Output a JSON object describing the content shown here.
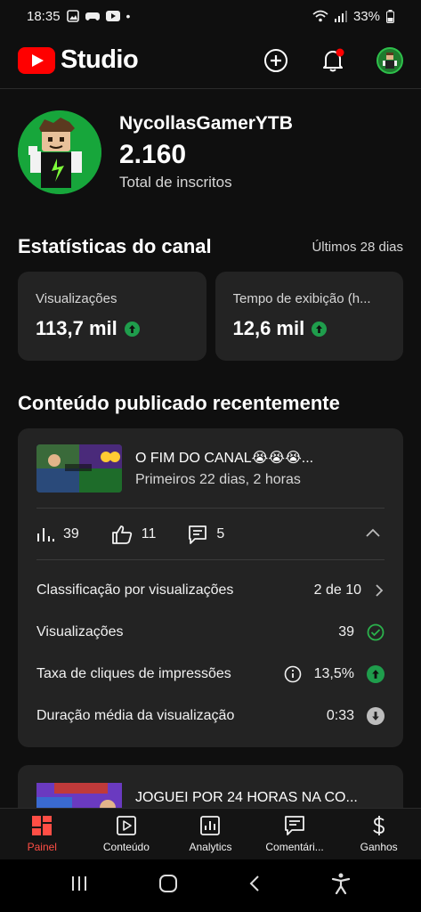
{
  "status_bar": {
    "time": "18:35",
    "battery": "33%"
  },
  "app": {
    "brand": "Studio",
    "accent": "#ff0000"
  },
  "channel": {
    "name": "NycollasGamerYTB",
    "subscribers": "2.160",
    "subscribers_label": "Total de inscritos"
  },
  "stats": {
    "title": "Estatísticas do canal",
    "period": "Últimos 28 dias",
    "cards": [
      {
        "label": "Visualizações",
        "value": "113,7 mil",
        "trend": "up"
      },
      {
        "label": "Tempo de exibição (h...",
        "value": "12,6 mil",
        "trend": "up"
      }
    ]
  },
  "recent": {
    "title": "Conteúdo publicado recentemente",
    "video": {
      "title": "O FIM DO CANAL😭😭😭...",
      "subtitle": "Primeiros 22 dias, 2 horas",
      "views": "39",
      "likes": "11",
      "comments": "5",
      "details": [
        {
          "label": "Classificação por visualizações",
          "value": "2 de 10",
          "indicator": "chevron-right"
        },
        {
          "label": "Visualizações",
          "value": "39",
          "indicator": "check"
        },
        {
          "label": "Taxa de cliques de impressões",
          "value": "13,5%",
          "indicator": "up"
        },
        {
          "label": "Duração média da visualização",
          "value": "0:33",
          "indicator": "down"
        }
      ]
    },
    "video2": {
      "title": "JOGUEI POR 24 HORAS NA CO..."
    }
  },
  "bottom_nav": [
    {
      "label": "Painel",
      "icon": "dashboard-icon",
      "active": true
    },
    {
      "label": "Conteúdo",
      "icon": "content-icon",
      "active": false
    },
    {
      "label": "Analytics",
      "icon": "analytics-icon",
      "active": false
    },
    {
      "label": "Comentári...",
      "icon": "comments-icon",
      "active": false
    },
    {
      "label": "Ganhos",
      "icon": "earn-icon",
      "active": false
    }
  ],
  "colors": {
    "background": "#0f0f0f",
    "card": "#232323",
    "positive": "#1f9d4c",
    "active_tab": "#ff4e45"
  }
}
